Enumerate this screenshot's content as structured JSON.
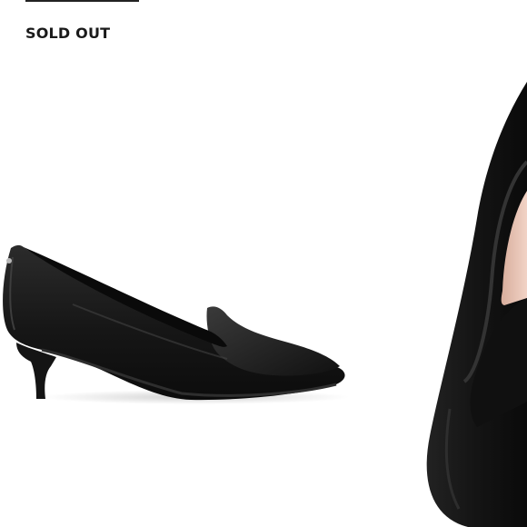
{
  "product": {
    "status": "SOLD OUT",
    "views": [
      {
        "name": "side-view",
        "description_icon": "pointed-toe-kitten-heel-loafer-pump"
      },
      {
        "name": "closeup-view",
        "description_icon": "toe-closeup"
      }
    ]
  },
  "colors": {
    "leather": "#1b1b1b",
    "leather_highlight": "#3c3c3c",
    "lining": "#e9c6b6",
    "text": "#1a1a1a"
  }
}
